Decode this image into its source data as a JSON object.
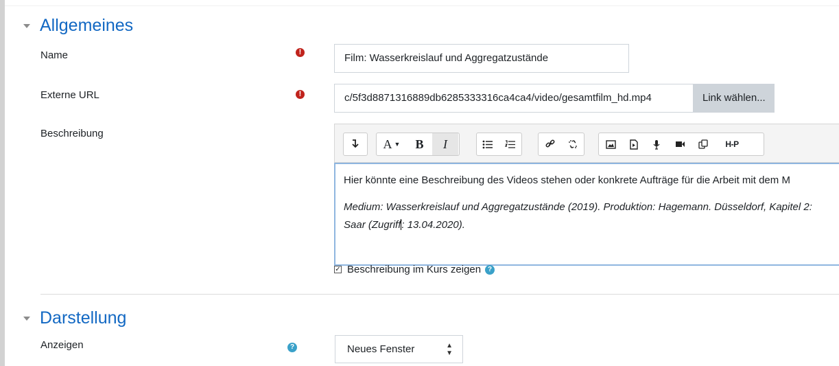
{
  "sections": {
    "general": "Allgemeines",
    "display": "Darstellung"
  },
  "fields": {
    "name": {
      "label": "Name",
      "value": "Film: Wasserkreislauf und Aggregatzustände"
    },
    "url": {
      "label": "Externe URL",
      "value": "c/5f3d8871316889db6285333316ca4ca4/video/gesamtfilm_hd.mp4",
      "button": "Link wählen..."
    },
    "description": {
      "label": "Beschreibung",
      "paragraph1": "Hier könnte eine Beschreibung des Videos stehen oder konkrete Aufträge für die Arbeit mit dem M",
      "paragraph2_line1": "Medium: Wasserkreislauf und Aggregatzustände (2019). Produktion: Hagemann. Düsseldorf, Kapitel 2:",
      "paragraph2_line2_a": "Saar (Zugriff",
      "paragraph2_line2_b": ": 13.04.2020)."
    },
    "show_description": {
      "label": "Beschreibung im Kurs zeigen",
      "checked": true
    },
    "display": {
      "label": "Anzeigen",
      "value": "Neues Fenster"
    }
  },
  "toolbar": {
    "bold": "B",
    "italic": "I",
    "h5p": "H-P",
    "font_a": "A"
  },
  "icons": {
    "required": "exclamation-circle-icon",
    "help": "question-circle-icon"
  },
  "colors": {
    "heading": "#1268c3",
    "required": "#c0231c",
    "help": "#3aa1c9",
    "editor_focus_border": "#8fb6df"
  }
}
